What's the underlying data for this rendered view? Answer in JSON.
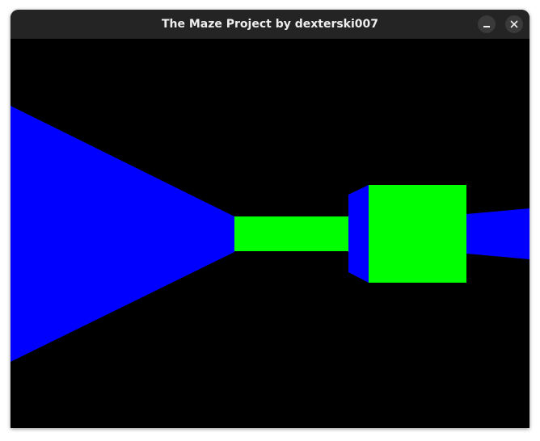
{
  "window": {
    "title": "The Maze Project by dexterski007",
    "buttons": {
      "minimize_icon": "minimize-icon",
      "close_icon": "close-icon"
    }
  },
  "scene": {
    "background_color": "#000000",
    "wall_colors": {
      "side_wall": "#0000ff",
      "front_wall": "#00ff00"
    }
  }
}
